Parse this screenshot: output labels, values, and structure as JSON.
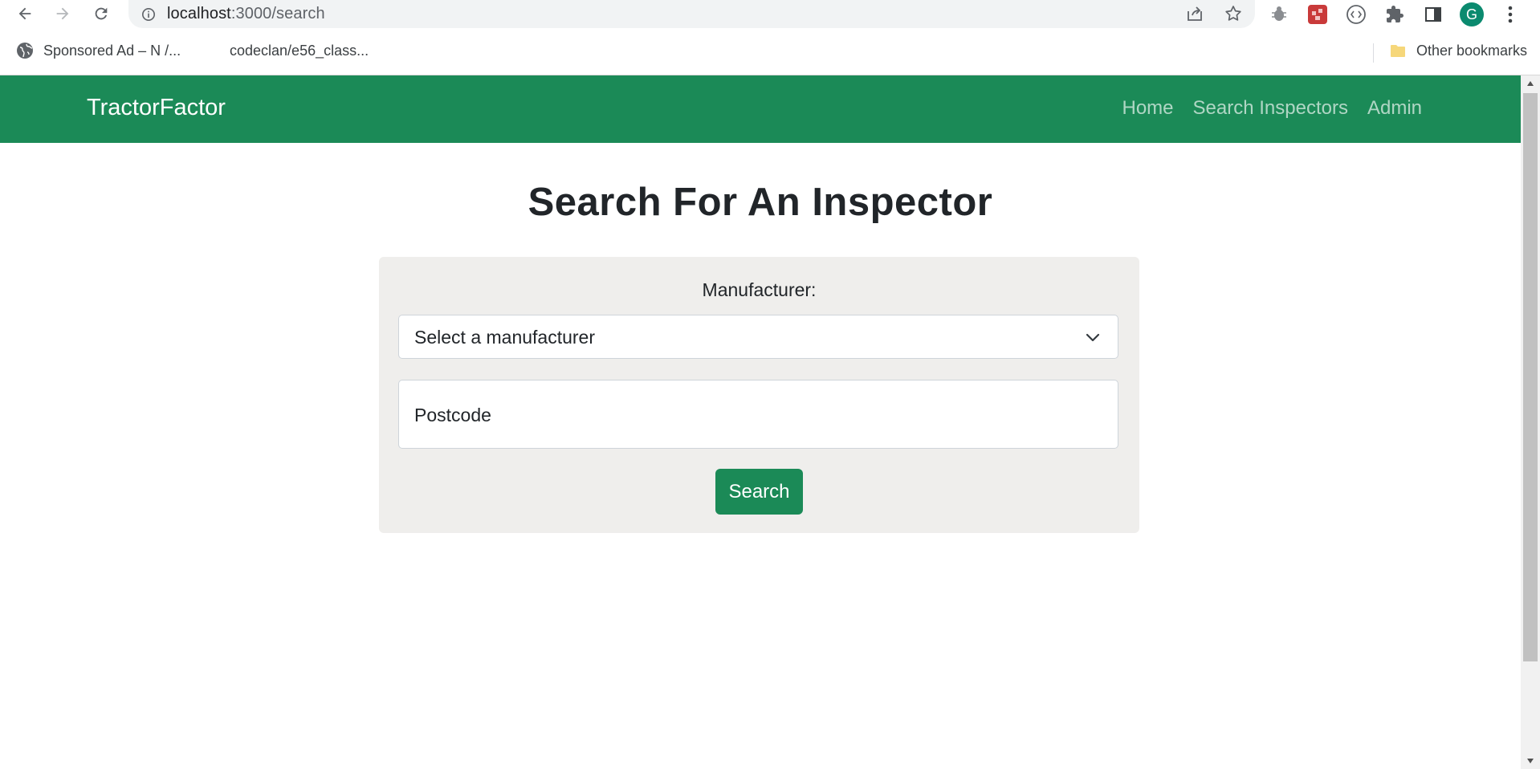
{
  "browser": {
    "url_host": "localhost",
    "url_rest": ":3000/search",
    "profile_initial": "G",
    "bookmarks": [
      {
        "label": "Sponsored Ad – N /...",
        "icon": "globe-icon"
      },
      {
        "label": "codeclan/e56_class...",
        "icon": "github-icon"
      }
    ],
    "other_bookmarks": "Other bookmarks"
  },
  "navbar": {
    "brand": "TractorFactor",
    "links": [
      "Home",
      "Search Inspectors",
      "Admin"
    ]
  },
  "main": {
    "title": "Search For An Inspector",
    "manufacturer_label": "Manufacturer:",
    "manufacturer_select": "Select a manufacturer",
    "postcode_placeholder": "Postcode",
    "search_button": "Search"
  },
  "colors": {
    "navbar_green": "#1b8a57",
    "card_background": "#efeeec",
    "button_green": "#1b8a57"
  }
}
